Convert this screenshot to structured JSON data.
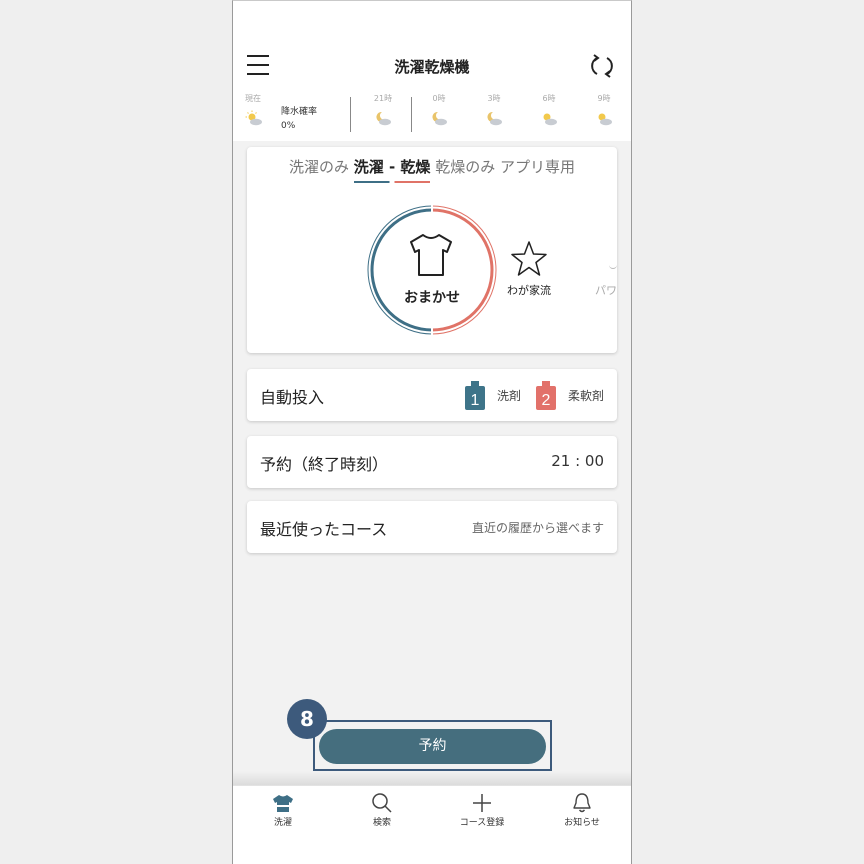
{
  "header": {
    "title": "洗濯乾燥機",
    "menu_icon": "hamburger-menu-icon",
    "refresh_icon": "refresh-icon"
  },
  "weather": {
    "now_label": "現在",
    "rain_label": "降水確率",
    "rain_value": "0%",
    "forecast": [
      {
        "time": "21時",
        "icon": "moon-cloud-icon"
      },
      {
        "time": "0時",
        "icon": "moon-cloud-icon"
      },
      {
        "time": "3時",
        "icon": "moon-cloud-icon"
      },
      {
        "time": "6時",
        "icon": "sun-cloud-icon"
      },
      {
        "time": "9時",
        "icon": "sun-cloud-icon"
      }
    ]
  },
  "mode_tabs": [
    {
      "label": "洗濯のみ",
      "active": false
    },
    {
      "label": "洗濯 - 乾燥",
      "active": true
    },
    {
      "label": "乾燥のみ",
      "active": false
    },
    {
      "label": "アプリ専用",
      "active": false
    }
  ],
  "courses": [
    {
      "label": "おまかせ",
      "icon": "shirt-icon",
      "selected": true
    },
    {
      "label": "わが家流",
      "icon": "star-icon",
      "selected": false
    },
    {
      "label": "パワ",
      "icon": "power-icon",
      "selected": false
    }
  ],
  "auto_dose": {
    "label": "自動投入",
    "detergent": {
      "number": "1",
      "label": "洗剤",
      "color": "#3e7489"
    },
    "softener": {
      "number": "2",
      "label": "柔軟剤",
      "color": "#e2716a"
    }
  },
  "reservation": {
    "label": "予約（終了時刻）",
    "time": "21 : 00"
  },
  "recent": {
    "label": "最近使ったコース",
    "hint": "直近の履歴から選べます"
  },
  "reserve_button": {
    "label": "予約"
  },
  "step_badge": "8",
  "bottom_nav": [
    {
      "label": "洗濯",
      "icon": "laundry-shirt-icon",
      "active": true
    },
    {
      "label": "検索",
      "icon": "search-icon",
      "active": false
    },
    {
      "label": "コース登録",
      "icon": "plus-icon",
      "active": false
    },
    {
      "label": "お知らせ",
      "icon": "bell-icon",
      "active": false
    }
  ],
  "colors": {
    "washer_blue": "#3e6f86",
    "dryer_coral": "#e07367",
    "button": "#456e7e",
    "highlight": "#3d5a7c"
  }
}
